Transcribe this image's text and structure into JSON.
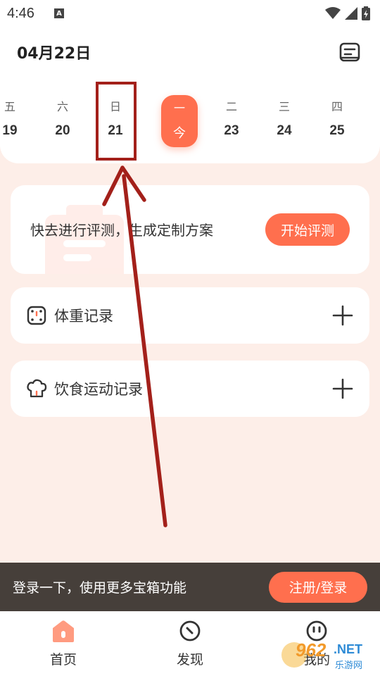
{
  "status_bar": {
    "time": "4:46",
    "notification": "A"
  },
  "header": {
    "date": "04月22日"
  },
  "week": [
    {
      "weekday": "五",
      "day": "19"
    },
    {
      "weekday": "六",
      "day": "20"
    },
    {
      "weekday": "日",
      "day": "21"
    },
    {
      "weekday": "一",
      "day": "今",
      "today": true
    },
    {
      "weekday": "二",
      "day": "23"
    },
    {
      "weekday": "三",
      "day": "24"
    },
    {
      "weekday": "四",
      "day": "25"
    }
  ],
  "assessment": {
    "prompt": "快去进行评测，生成定制方案",
    "button": "开始评测"
  },
  "records": {
    "weight_label": "体重记录",
    "diet_label": "饮食运动记录"
  },
  "login_bar": {
    "text": "登录一下，使用更多宝箱功能",
    "button": "注册/登录"
  },
  "nav": {
    "home": "首页",
    "discover": "发现",
    "mine": "我的"
  },
  "watermark": {
    "num": "962",
    "net": ".NET",
    "site": "乐游网"
  },
  "colors": {
    "accent": "#ff6f4e",
    "annotation": "#a3201a",
    "background": "#fdeee8"
  }
}
